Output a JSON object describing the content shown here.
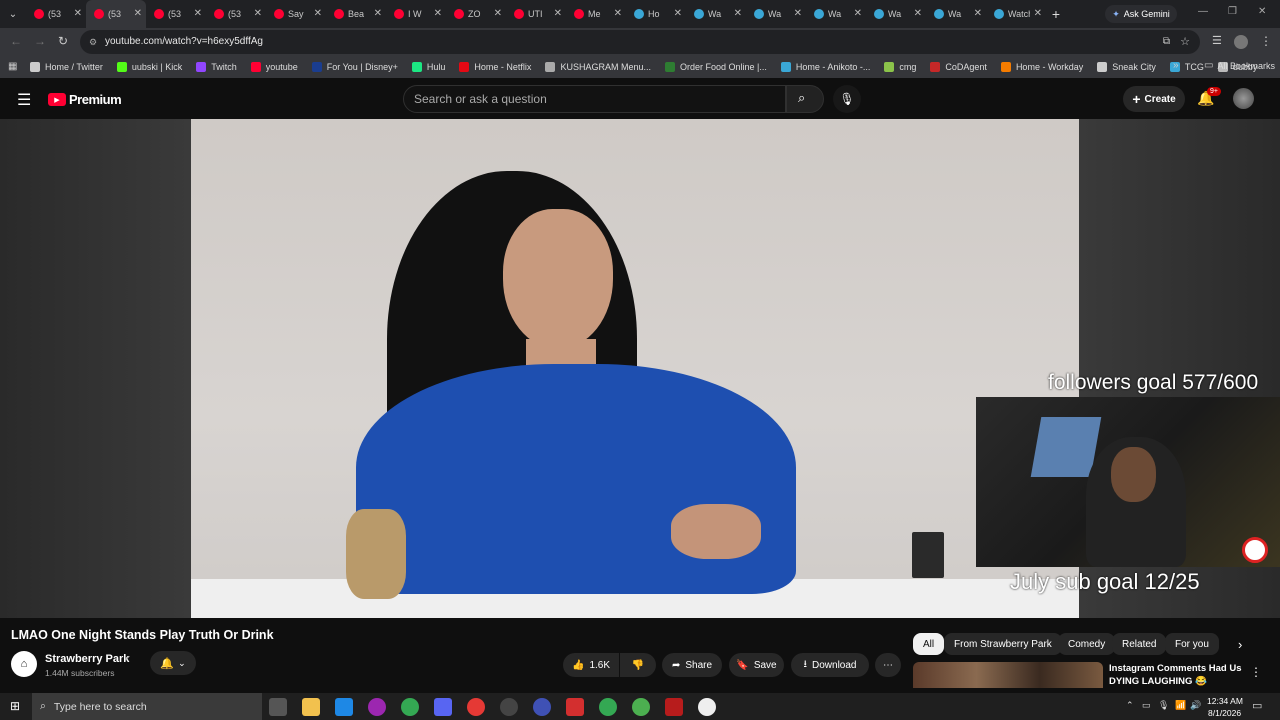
{
  "tabs": [
    {
      "title": "(53",
      "icon": "youtube-icon"
    },
    {
      "title": "(53",
      "icon": "youtube-icon",
      "active": true
    },
    {
      "title": "(53",
      "icon": "youtube-icon"
    },
    {
      "title": "(53",
      "icon": "youtube-icon"
    },
    {
      "title": "Say",
      "icon": "youtube-icon"
    },
    {
      "title": "Bea",
      "icon": "youtube-icon"
    },
    {
      "title": "I W",
      "icon": "youtube-icon"
    },
    {
      "title": "ZO",
      "icon": "youtube-icon"
    },
    {
      "title": "UTI",
      "icon": "youtube-icon"
    },
    {
      "title": "Me",
      "icon": "youtube-icon"
    },
    {
      "title": "Ho",
      "icon": "chat-icon"
    },
    {
      "title": "Wa",
      "icon": "chat-icon"
    },
    {
      "title": "Wa",
      "icon": "chat-icon"
    },
    {
      "title": "Wa",
      "icon": "chat-icon"
    },
    {
      "title": "Wa",
      "icon": "chat-icon"
    },
    {
      "title": "Wa",
      "icon": "chat-icon"
    },
    {
      "title": "Watch",
      "icon": "chat-icon"
    }
  ],
  "browser": {
    "url": "youtube.com/watch?v=h6exy5dffAg",
    "gemini": "Ask Gemini",
    "all_bookmarks": "All Bookmarks"
  },
  "bookmarks": [
    "Home / Twitter",
    "uubski | Kick",
    "Twitch",
    "youtube",
    "For You | Disney+",
    "Hulu",
    "Home - Netflix",
    "KUSHAGRAM Menu...",
    "Order Food Online |...",
    "Home - Anikoto -...",
    "cmg",
    "CoDAgent",
    "Home - Workday",
    "Sneak City",
    "TCG",
    "dubby"
  ],
  "youtube": {
    "logo": "Premium",
    "search_placeholder": "Search or ask a question",
    "create": "Create",
    "notifications": "9+"
  },
  "stream_overlay": {
    "followers_goal": "followers goal 577/600",
    "sub_goal": "July sub goal 12/25"
  },
  "video": {
    "title": "LMAO One Night Stands Play Truth Or Drink",
    "channel": "Strawberry Park",
    "subscribers": "1.44M subscribers",
    "likes": "1.6K",
    "share": "Share",
    "save": "Save",
    "download": "Download"
  },
  "chips": [
    "All",
    "From Strawberry Park",
    "Comedy",
    "Related",
    "For you"
  ],
  "recommended": {
    "title_line1": "Instagram Comments Had Us",
    "title_line2": "DYING LAUGHING 😂"
  },
  "taskbar": {
    "search_placeholder": "Type here to search",
    "time": "12:34 AM",
    "date": "8/1/2026"
  },
  "colors": {
    "youtube_red": "#ff0033",
    "background": "#0f0f0f"
  }
}
